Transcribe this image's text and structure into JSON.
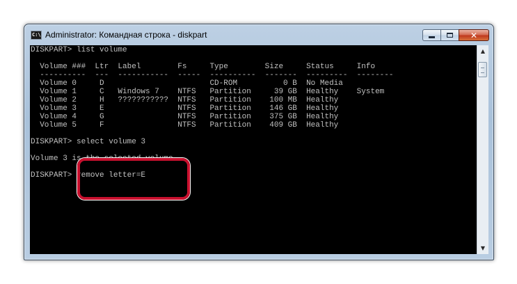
{
  "window": {
    "title": "Administrator: Командная строка - diskpart",
    "icon_label": "C:\\",
    "icon": "cmd-icon",
    "buttons": {
      "minimize": "minimize-icon",
      "maximize": "maximize-icon",
      "close": "close-icon",
      "close_glyph": "✕"
    }
  },
  "console": {
    "lines": [
      "DISKPART> list volume",
      "",
      "  Volume ###  Ltr  Label        Fs     Type        Size     Status     Info",
      "  ----------  ---  -----------  -----  ----------  -------  ---------  --------",
      "  Volume 0     D                       CD-ROM          0 B  No Media",
      "  Volume 1     C   Windows 7    NTFS   Partition     39 GB  Healthy    System",
      "  Volume 2     H   ???????????  NTFS   Partition    100 MB  Healthy",
      "  Volume 3     E                NTFS   Partition    146 GB  Healthy",
      "  Volume 4     G                NTFS   Partition    375 GB  Healthy",
      "  Volume 5     F                NTFS   Partition    409 GB  Healthy",
      "",
      "DISKPART> select volume 3",
      "",
      "Volume 3 is the selected volume.",
      "",
      "DISKPART> remove letter=E"
    ],
    "text_color": "#c0c0c0",
    "background": "#000000"
  },
  "scrollbar": {
    "up_icon": "scroll-up-arrow-icon",
    "down_icon": "scroll-down-arrow-icon",
    "up_glyph": "▲",
    "down_glyph": "▼"
  },
  "annotation": {
    "color": "#c8102e"
  }
}
